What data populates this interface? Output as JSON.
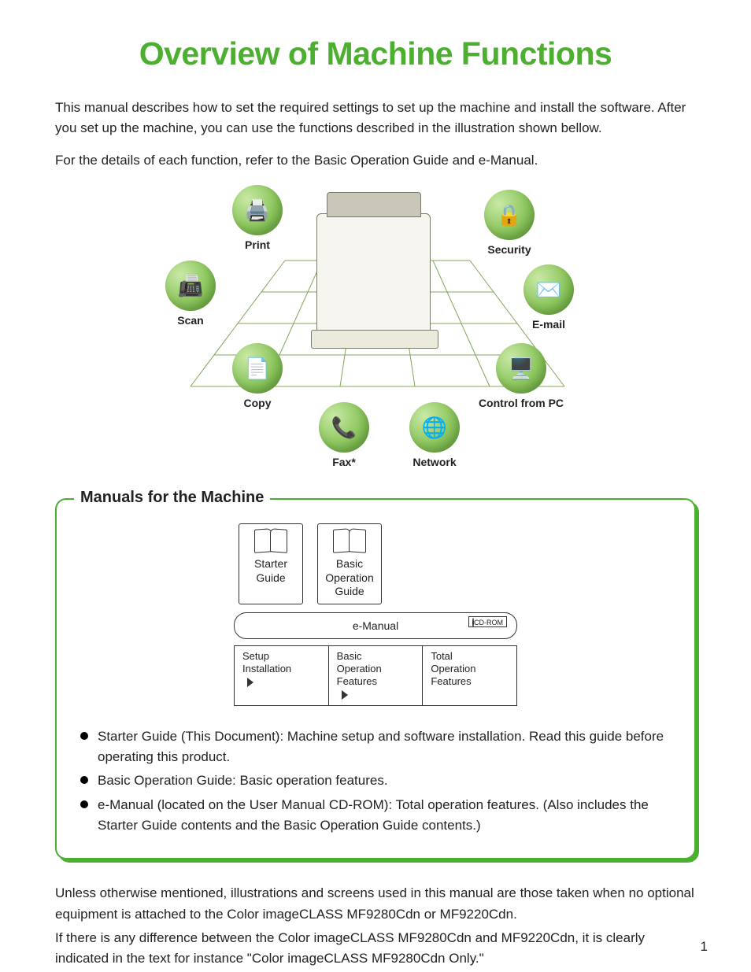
{
  "title": "Overview of Machine Functions",
  "intro": {
    "p1": "This manual describes how to set the required settings to set up the machine and install the software. After you set up the machine, you can use the functions described in the illustration shown bellow.",
    "p2": "For the details of each function, refer to the Basic Operation Guide and e-Manual."
  },
  "functions": {
    "print": {
      "label": "Print",
      "icon": "🖨️"
    },
    "security": {
      "label": "Security",
      "icon": "🔒"
    },
    "scan": {
      "label": "Scan",
      "icon": "📠"
    },
    "email": {
      "label": "E-mail",
      "icon": "✉️"
    },
    "copy": {
      "label": "Copy",
      "icon": "📄"
    },
    "control": {
      "label": "Control from PC",
      "icon": "🖥️"
    },
    "fax": {
      "label": "Fax*",
      "icon": "📞"
    },
    "network": {
      "label": "Network",
      "icon": "🌐"
    }
  },
  "manuals": {
    "heading": "Manuals for the Machine",
    "starter": {
      "line1": "Starter",
      "line2": "Guide"
    },
    "basic": {
      "line1": "Basic",
      "line2": "Operation",
      "line3": "Guide"
    },
    "emanual": "e-Manual",
    "cdrom": "CD-ROM",
    "scopes": {
      "setup": {
        "l1": "Setup",
        "l2": "Installation"
      },
      "basic": {
        "l1": "Basic",
        "l2": "Operation",
        "l3": "Features"
      },
      "total": {
        "l1": "Total",
        "l2": "Operation",
        "l3": "Features"
      }
    },
    "bullets": {
      "b1": "Starter Guide (This Document): Machine setup and software installation. Read this guide before operating this product.",
      "b2": "Basic Operation Guide: Basic operation features.",
      "b3": "e-Manual (located on the User Manual CD-ROM): Total operation features. (Also includes the Starter Guide contents and the Basic Operation Guide contents.)"
    }
  },
  "footer": {
    "p1": "Unless otherwise mentioned, illustrations and screens used in this manual are those taken when no optional equipment is attached to the Color imageCLASS MF9280Cdn or MF9220Cdn.",
    "p2": "If there is any difference between the Color imageCLASS MF9280Cdn and MF9220Cdn, it is clearly indicated in the text for instance \"Color imageCLASS MF9280Cdn Only.\""
  },
  "page_number": "1"
}
